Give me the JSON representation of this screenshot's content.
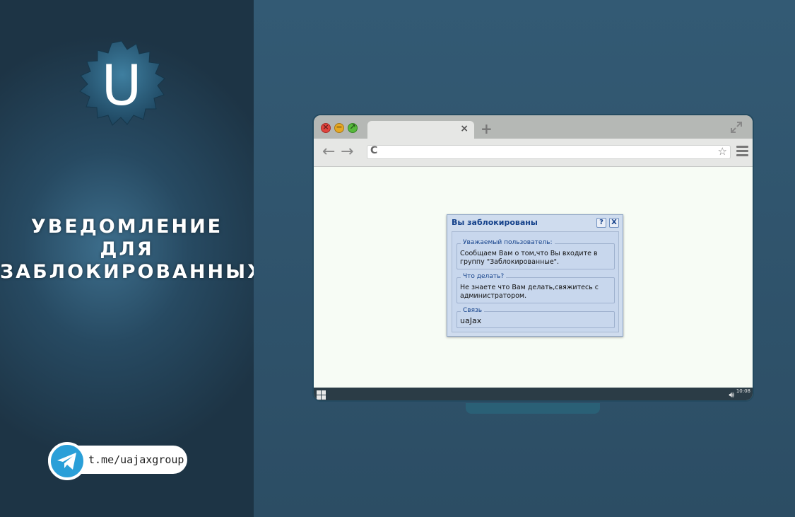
{
  "promo": {
    "title_lines": [
      "УВЕДОМЛЕНИЕ",
      "ДЛЯ",
      "ЗАБЛОКИРОВАННЫХ"
    ],
    "logo_letter": "U",
    "telegram_link": "t.me/uajaxgroup"
  },
  "browser": {
    "tab_close": "×",
    "new_tab": "+",
    "nav_back": "←",
    "nav_forward": "→",
    "reload": "C",
    "star": "☆",
    "address_value": ""
  },
  "dialog": {
    "title": "Вы заблокированы",
    "help_label": "?",
    "close_label": "X",
    "sections": [
      {
        "legend": "Уважаемый пользователь:",
        "text": "Сообщаем Вам о том,что Вы входите в группу \"Заблокированные\"."
      },
      {
        "legend": "Что делать?",
        "text": "Не знаете что Вам делать,свяжитесь с администратором."
      },
      {
        "legend": "Связь",
        "text": "uaJax"
      }
    ]
  },
  "taskbar": {
    "clock": "10:08",
    "speaker_icon": "speaker-icon",
    "start_icon": "windows-icon"
  },
  "colors": {
    "dialog_title": "#15428b",
    "telegram": "#2a9fd8",
    "page_bg": "#f7fcf5"
  }
}
